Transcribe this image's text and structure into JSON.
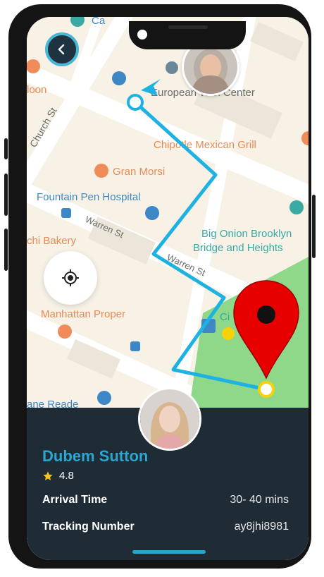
{
  "map": {
    "place_labels": [
      {
        "text": "loon",
        "color": "orange"
      },
      {
        "text": "European Wax Center",
        "color": "gray"
      },
      {
        "text": "Church St",
        "color": "gray"
      },
      {
        "text": "Chipotle Mexican Grill",
        "color": "orange"
      },
      {
        "text": "Gran Morsi",
        "color": "orange"
      },
      {
        "text": "Fountain Pen Hospital",
        "color": "blue"
      },
      {
        "text": "Warren St",
        "color": "gray"
      },
      {
        "text": "chi Bakery",
        "color": "orange"
      },
      {
        "text": "Big Onion Brooklyn",
        "color": "teal"
      },
      {
        "text": "Bridge and Heights",
        "color": "teal"
      },
      {
        "text": "Warren St",
        "color": "gray"
      },
      {
        "text": "Manhattan Proper",
        "color": "orange"
      },
      {
        "text": "Ci",
        "color": "teal"
      },
      {
        "text": "ane Reade",
        "color": "blue"
      },
      {
        "text": "Ca",
        "color": "blue"
      }
    ],
    "route_color": "#1eb2e3",
    "destination_pin_color": "#e60000",
    "start_marker_color": "#1eb2e3",
    "end_marker_color": "#f5d20a"
  },
  "nav": {
    "back_icon": "chevron-left-icon",
    "locate_icon": "crosshair-icon"
  },
  "driver": {
    "name": "Dubem Sutton",
    "rating": "4.8",
    "rating_icon": "star-icon",
    "rating_color": "#f5c518"
  },
  "details": {
    "arrival_label": "Arrival Time",
    "arrival_value": "30- 40 mins",
    "tracking_label": "Tracking Number",
    "tracking_value": "ay8jhi8981"
  },
  "colors": {
    "accent": "#2aa7cf",
    "sheet_bg": "#1f2b35",
    "park_green": "#8fd88a"
  }
}
